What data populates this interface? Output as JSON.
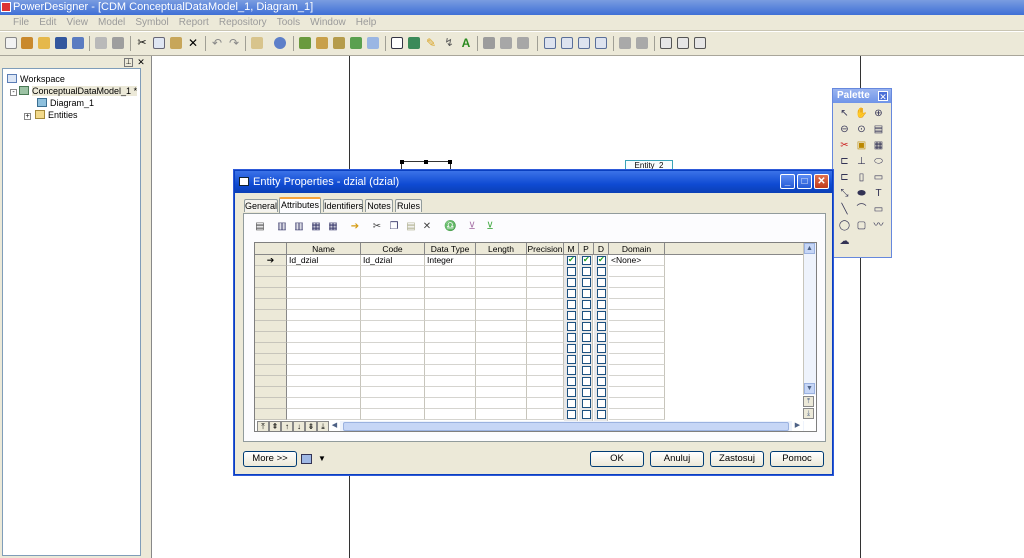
{
  "app": {
    "title": "PowerDesigner - [CDM ConceptualDataModel_1, Diagram_1]",
    "menu": [
      "File",
      "Edit",
      "View",
      "Model",
      "Symbol",
      "Report",
      "Repository",
      "Tools",
      "Window",
      "Help"
    ]
  },
  "browser": {
    "workspace": "Workspace",
    "model": "ConceptualDataModel_1 *",
    "diagram": "Diagram_1",
    "entities": "Entities"
  },
  "canvas": {
    "entity2_label": "Entity_2"
  },
  "palette": {
    "title": "Palette",
    "close": "✕"
  },
  "dialog": {
    "title": "Entity Properties - dzial (dzial)",
    "tabs": [
      "General",
      "Attributes",
      "Identifiers",
      "Notes",
      "Rules"
    ],
    "active_tab": "Attributes",
    "columns": [
      "Name",
      "Code",
      "Data Type",
      "Length",
      "Precision",
      "M",
      "P",
      "D",
      "Domain"
    ],
    "rows": [
      {
        "name": "Id_dzial",
        "code": "Id_dzial",
        "data_type": "Integer",
        "length": "",
        "precision": "",
        "m": true,
        "p": true,
        "d": true,
        "domain": "<None>"
      }
    ],
    "current_row_marker": "➔",
    "buttons": {
      "more": "More >>",
      "ok": "OK",
      "cancel": "Anuluj",
      "apply": "Zastosuj",
      "help": "Pomoc"
    }
  }
}
